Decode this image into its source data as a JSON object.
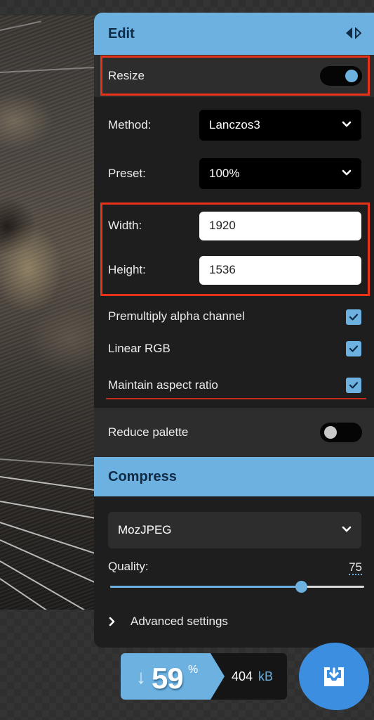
{
  "edit": {
    "title": "Edit",
    "toggle_panel_icon": "split-arrows-icon",
    "resize": {
      "label": "Resize",
      "enabled": true
    },
    "method": {
      "label": "Method:",
      "value": "Lanczos3"
    },
    "preset": {
      "label": "Preset:",
      "value": "100%"
    },
    "width": {
      "label": "Width:",
      "value": "1920"
    },
    "height": {
      "label": "Height:",
      "value": "1536"
    },
    "options": [
      {
        "label": "Premultiply alpha channel",
        "checked": true
      },
      {
        "label": "Linear RGB",
        "checked": true
      },
      {
        "label": "Maintain aspect ratio",
        "checked": true
      }
    ],
    "reduce_palette": {
      "label": "Reduce palette",
      "enabled": false
    }
  },
  "compress": {
    "title": "Compress",
    "codec": "MozJPEG",
    "quality": {
      "label": "Quality:",
      "value": "75",
      "fraction": 0.75
    },
    "advanced": {
      "label": "Advanced settings",
      "icon": "chevron-right-icon"
    }
  },
  "result": {
    "arrow": "↓",
    "savings": "59",
    "percent_symbol": "%",
    "size": "404",
    "unit": "kB",
    "download_icon": "download-tray-icon"
  },
  "colors": {
    "accent": "#6db1e1",
    "header_text": "#0f2b45",
    "highlight": "#e8321a",
    "download_button": "#3b8ee0"
  }
}
